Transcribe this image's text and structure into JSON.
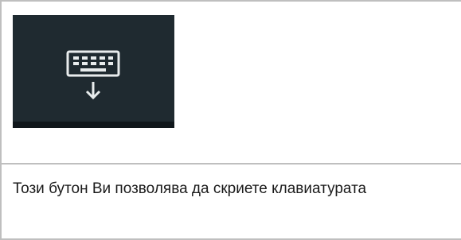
{
  "button": {
    "icon": "hide-keyboard-icon",
    "background_color": "#1f2a30",
    "icon_color": "#e8eced"
  },
  "description": {
    "text": "Този бутон Ви позволява да скриете клавиатурата"
  }
}
